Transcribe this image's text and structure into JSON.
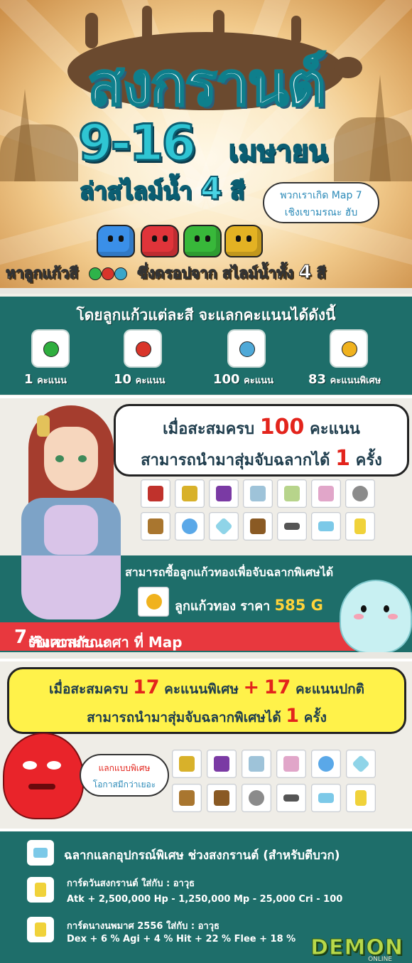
{
  "header": {
    "title": "สงกรานต์",
    "date_range": "9-16",
    "month": "เมษายน",
    "subtitle_prefix": "ล่าสไลม์น้ำ",
    "subtitle_number": "4",
    "subtitle_suffix": "สี",
    "speech_line1": "พวกเราเกิด Map 7",
    "speech_line2": "เชิงเขามรณะ ฮับ",
    "collect_prefix": "หาลูกแก้วสี",
    "collect_mid": "ซึ่งดรอปจาก สไลม์น้ำทั้ง",
    "collect_number": "4",
    "collect_suffix": "สี",
    "slime_colors": [
      "#3a8fe8",
      "#e0343a",
      "#38b83a",
      "#e3b223"
    ],
    "gem_colors": [
      "#2eb34a",
      "#d8342b",
      "#3aa6c9"
    ]
  },
  "points": {
    "title": "โดยลูกแก้วแต่ละสี จะแลกคะแนนได้ดังนี้",
    "items": [
      {
        "icon": "green-gem-icon",
        "color": "#2fae3e",
        "number": "1",
        "unit": "คะแนน"
      },
      {
        "icon": "red-gem-icon",
        "color": "#d9352a",
        "number": "10",
        "unit": "คะแนน"
      },
      {
        "icon": "blue-gem-icon",
        "color": "#4fa9d8",
        "number": "100",
        "unit": "คะแนน"
      },
      {
        "icon": "gold-gem-icon",
        "color": "#f0b21e",
        "number": "83",
        "unit": "คะแนนพิเศษ"
      }
    ]
  },
  "prize1": {
    "line1_prefix": "เมื่อสะสมครบ",
    "line1_number": "100",
    "line1_suffix": "คะแนน",
    "line2_prefix": "สามารถนำมาสุ่มจับฉลากได้",
    "line2_number": "1",
    "line2_suffix": "ครั้ง",
    "items": [
      "red-figure-icon",
      "gold-trophy-icon",
      "purple-figure-icon",
      "scroll-blue-icon",
      "scroll-green-icon",
      "scroll-pink-icon",
      "ore-stone-icon",
      "gift-box-icon",
      "blue-orb-icon",
      "crystal-icon",
      "treasure-chest-icon",
      "dumbbell-icon",
      "ticket-icon",
      "yellow-card-icon"
    ]
  },
  "gold": {
    "title": "สามารถซื้อลูกแก้วทองเพื่อจับฉลากพิเศษได้",
    "item_name": "ลูกแก้วทอง",
    "price_label": "ราคา",
    "price": "585 G",
    "quest_prefix": "รับเควสกับ เกศา ที่ Map",
    "quest_number": "7",
    "quest_suffix": "เชิงเขามรณะ"
  },
  "prize2": {
    "line1_prefix": "เมื่อสะสมครบ",
    "line1_num1": "17",
    "line1_mid": "คะแนนพิเศษ",
    "line1_plus": "+",
    "line1_num2": "17",
    "line1_suffix": "คะแนนปกติ",
    "line2_prefix": "สามารถนำมาสุ่มจับฉลากพิเศษได้",
    "line2_number": "1",
    "line2_suffix": "ครั้ง",
    "speech_line1": "แลกแบบพิเศษ",
    "speech_line2": "โอกาสมีกว่าเยอะ",
    "items": [
      "gold-trophy-icon",
      "purple-figure-icon",
      "scroll-blue-icon",
      "scroll-pink-icon",
      "blue-orb-icon",
      "crystal-icon",
      "gift-box-icon",
      "treasure-chest-icon",
      "ore-stone-icon",
      "dumbbell-icon",
      "ticket-icon",
      "yellow-card-icon"
    ]
  },
  "coupons": {
    "row1": "ฉลากแลกอุปกรณ์พิเศษ ช่วงสงกรานต์ (สำหรับตีบวก)",
    "row2_title": "การ์ดวันสงกรานต์ ใส่กับ : อาวุธ",
    "row2_stats": "Atk + 2,500,000 Hp - 1,250,000 Mp - 25,000 Cri - 100",
    "row3_title": "การ์ดนางนพมาศ 2556 ใส่กับ : อาวุธ",
    "row3_stats": "Dex + 6 % Agi + 4 % Hit + 22 % Flee + 18 %",
    "logo": "DEMON",
    "logo_sub": "ONLINE"
  }
}
